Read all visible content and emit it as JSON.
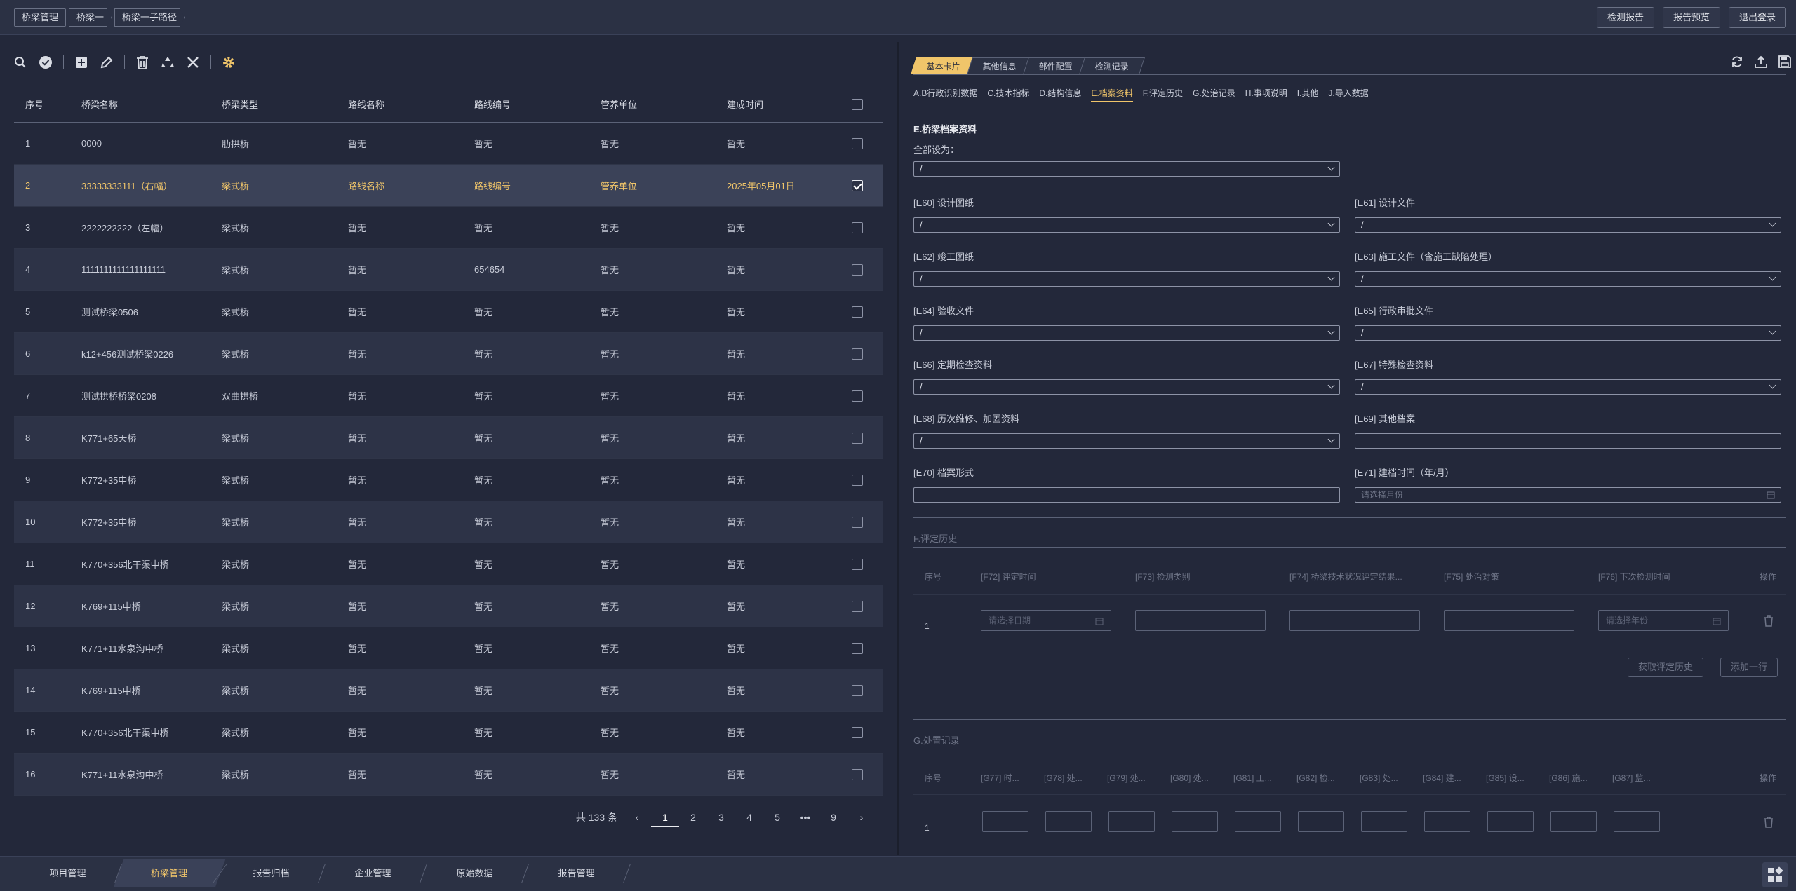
{
  "breadcrumb": [
    "桥梁管理",
    "桥梁一",
    "桥梁一子路径"
  ],
  "header_buttons": [
    "检测报告",
    "报告预览",
    "退出登录"
  ],
  "toolbar_icons": [
    "search-icon",
    "check-circle-icon",
    "add-icon",
    "edit-icon",
    "delete-icon",
    "recycle-icon",
    "close-icon",
    "settings-icon"
  ],
  "table": {
    "columns": [
      "序号",
      "桥梁名称",
      "桥梁类型",
      "路线名称",
      "路线编号",
      "管养单位",
      "建成时间"
    ],
    "rows": [
      {
        "no": "1",
        "name": "0000",
        "type": "肋拱桥",
        "route": "暂无",
        "code": "暂无",
        "unit": "暂无",
        "time": "暂无",
        "checked": false
      },
      {
        "no": "2",
        "name": "33333333111（右幅）",
        "type": "梁式桥",
        "route": "路线名称",
        "code": "路线编号",
        "unit": "管养单位",
        "time": "2025年05月01日",
        "checked": true
      },
      {
        "no": "3",
        "name": "2222222222（左幅）",
        "type": "梁式桥",
        "route": "暂无",
        "code": "暂无",
        "unit": "暂无",
        "time": "暂无",
        "checked": false
      },
      {
        "no": "4",
        "name": "1111111111111111111",
        "type": "梁式桥",
        "route": "暂无",
        "code": "654654",
        "unit": "暂无",
        "time": "暂无",
        "checked": false
      },
      {
        "no": "5",
        "name": "测试桥梁0506",
        "type": "梁式桥",
        "route": "暂无",
        "code": "暂无",
        "unit": "暂无",
        "time": "暂无",
        "checked": false
      },
      {
        "no": "6",
        "name": "k12+456测试桥梁0226",
        "type": "梁式桥",
        "route": "暂无",
        "code": "暂无",
        "unit": "暂无",
        "time": "暂无",
        "checked": false
      },
      {
        "no": "7",
        "name": "测试拱桥桥梁0208",
        "type": "双曲拱桥",
        "route": "暂无",
        "code": "暂无",
        "unit": "暂无",
        "time": "暂无",
        "checked": false
      },
      {
        "no": "8",
        "name": "K771+65天桥",
        "type": "梁式桥",
        "route": "暂无",
        "code": "暂无",
        "unit": "暂无",
        "time": "暂无",
        "checked": false
      },
      {
        "no": "9",
        "name": "K772+35中桥",
        "type": "梁式桥",
        "route": "暂无",
        "code": "暂无",
        "unit": "暂无",
        "time": "暂无",
        "checked": false
      },
      {
        "no": "10",
        "name": "K772+35中桥",
        "type": "梁式桥",
        "route": "暂无",
        "code": "暂无",
        "unit": "暂无",
        "time": "暂无",
        "checked": false
      },
      {
        "no": "11",
        "name": "K770+356北干渠中桥",
        "type": "梁式桥",
        "route": "暂无",
        "code": "暂无",
        "unit": "暂无",
        "time": "暂无",
        "checked": false
      },
      {
        "no": "12",
        "name": "K769+115中桥",
        "type": "梁式桥",
        "route": "暂无",
        "code": "暂无",
        "unit": "暂无",
        "time": "暂无",
        "checked": false
      },
      {
        "no": "13",
        "name": "K771+11水泉沟中桥",
        "type": "梁式桥",
        "route": "暂无",
        "code": "暂无",
        "unit": "暂无",
        "time": "暂无",
        "checked": false
      },
      {
        "no": "14",
        "name": "K769+115中桥",
        "type": "梁式桥",
        "route": "暂无",
        "code": "暂无",
        "unit": "暂无",
        "time": "暂无",
        "checked": false
      },
      {
        "no": "15",
        "name": "K770+356北干渠中桥",
        "type": "梁式桥",
        "route": "暂无",
        "code": "暂无",
        "unit": "暂无",
        "time": "暂无",
        "checked": false
      },
      {
        "no": "16",
        "name": "K771+11水泉沟中桥",
        "type": "梁式桥",
        "route": "暂无",
        "code": "暂无",
        "unit": "暂无",
        "time": "暂无",
        "checked": false
      }
    ]
  },
  "pager": {
    "total": "共 133 条",
    "prev": "‹",
    "pages": [
      "1",
      "2",
      "3",
      "4",
      "5",
      "•••",
      "9"
    ],
    "current": "1",
    "next": "›"
  },
  "right": {
    "tabs": [
      "基本卡片",
      "其他信息",
      "部件配置",
      "检测记录"
    ],
    "active_tab": "基本卡片",
    "subtabs": [
      "A.B行政识别数据",
      "C.技术指标",
      "D.结构信息",
      "E.档案资料",
      "F.评定历史",
      "G.处治记录",
      "H.事项说明",
      "I.其他",
      "J.导入数据"
    ],
    "active_subtab": "E.档案资料",
    "section_e": {
      "title": "E.桥梁档案资料",
      "set_all_label": "全部设为：",
      "set_all_value": "/",
      "fields": [
        {
          "label": "[E60] 设计图纸",
          "value": "/"
        },
        {
          "label": "[E61] 设计文件",
          "value": "/"
        },
        {
          "label": "[E62] 竣工图纸",
          "value": "/"
        },
        {
          "label": "[E63] 施工文件（含施工缺陷处理）",
          "value": "/"
        },
        {
          "label": "[E64] 验收文件",
          "value": "/"
        },
        {
          "label": "[E65] 行政审批文件",
          "value": "/"
        },
        {
          "label": "[E66] 定期检查资料",
          "value": "/"
        },
        {
          "label": "[E67] 特殊检查资料",
          "value": "/"
        },
        {
          "label": "[E68] 历次维修、加固资料",
          "value": "/"
        },
        {
          "label": "[E69] 其他档案",
          "value": ""
        },
        {
          "label": "[E70] 档案形式",
          "value": ""
        },
        {
          "label": "[E71] 建档时间（年/月）",
          "placeholder": "请选择月份"
        }
      ]
    },
    "section_f": {
      "title": "F.评定历史",
      "columns": [
        "序号",
        "[F72] 评定时间",
        "[F73] 检测类别",
        "[F74] 桥梁技术状况评定结果...",
        "[F75] 处治对策",
        "[F76] 下次检测时间",
        "操作"
      ],
      "row_no": "1",
      "date_placeholder": "请选择日期",
      "year_placeholder": "请选择年份",
      "buttons": [
        "获取评定历史",
        "添加一行"
      ]
    },
    "section_g": {
      "title": "G.处置记录",
      "columns": [
        "序号",
        "[G77] 时...",
        "[G78] 处...",
        "[G79] 处...",
        "[G80] 处...",
        "[G81] 工...",
        "[G82] 检...",
        "[G83] 处...",
        "[G84] 建...",
        "[G85] 设...",
        "[G86] 施...",
        "[G87] 监...",
        "操作"
      ],
      "row_no": "1"
    }
  },
  "bottom_tabs": [
    "项目管理",
    "桥梁管理",
    "报告归档",
    "企业管理",
    "原始数据",
    "报告管理"
  ],
  "active_bottom_tab": "桥梁管理",
  "colors": {
    "accent": "#f0c56a",
    "bg": "#23283a",
    "panel": "#2b3144"
  }
}
